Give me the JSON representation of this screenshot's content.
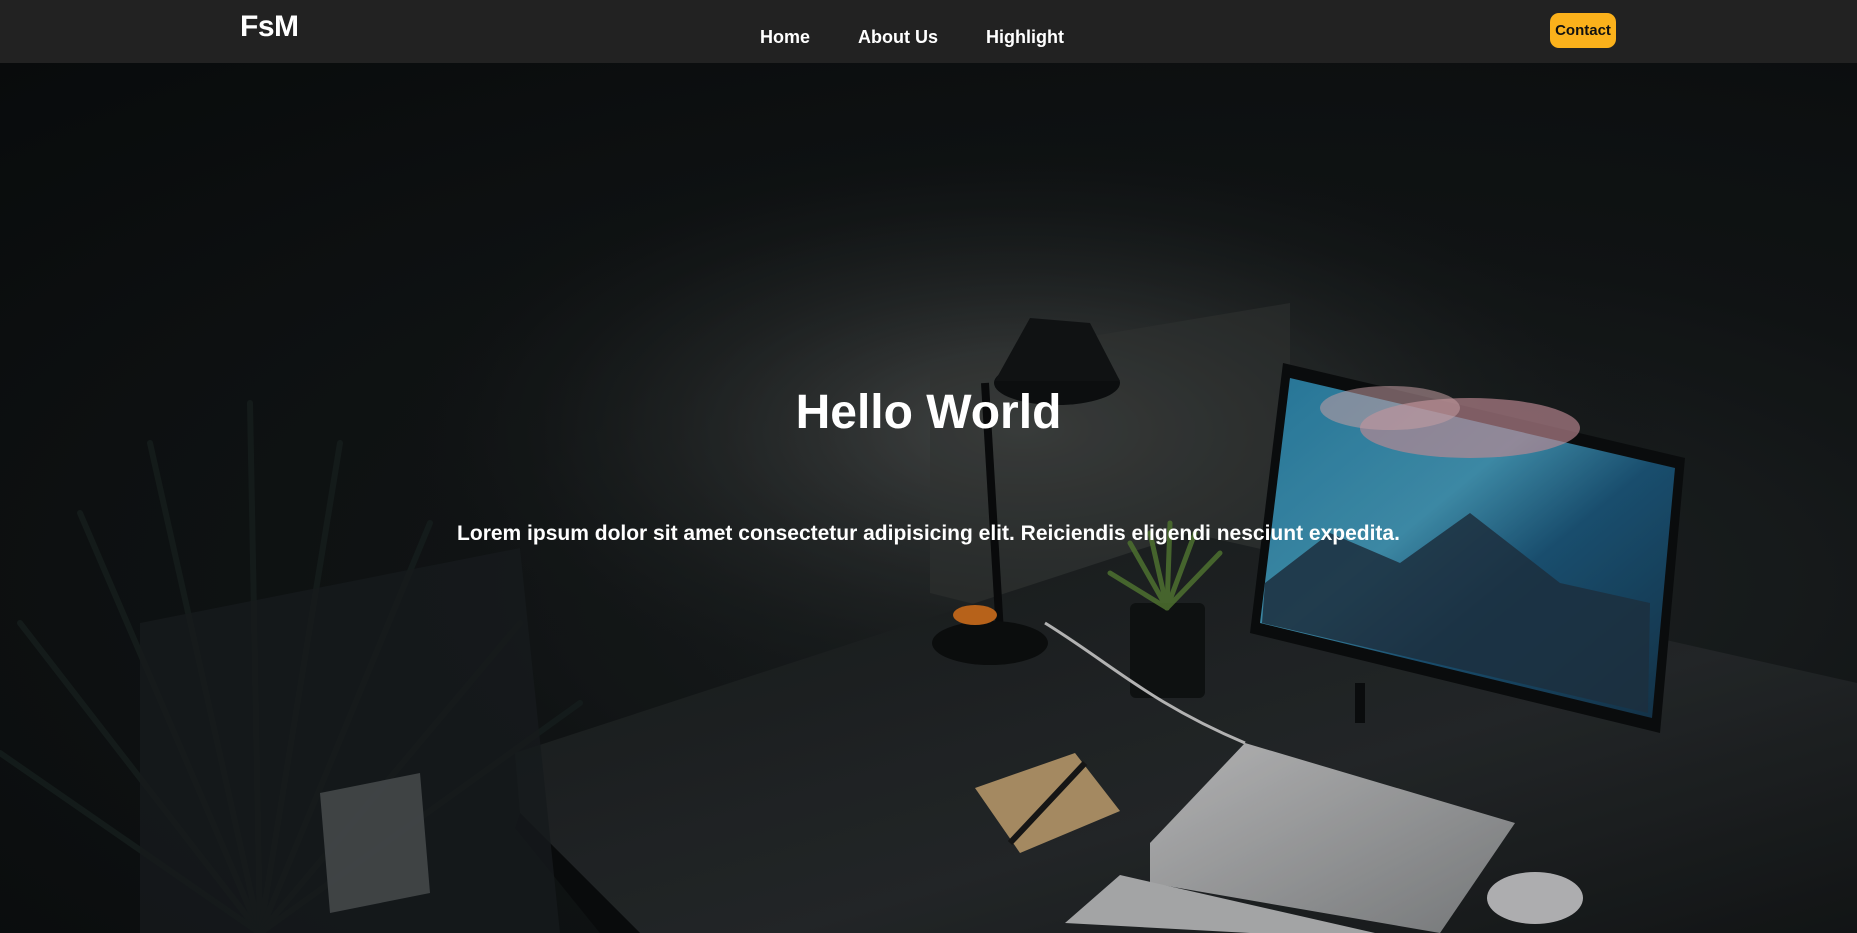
{
  "header": {
    "logo": "FsM",
    "nav": [
      {
        "label": "Home"
      },
      {
        "label": "About Us"
      },
      {
        "label": "Highlight"
      }
    ],
    "contact_label": "Contact"
  },
  "hero": {
    "title": "Hello World",
    "subtitle": "Lorem ipsum dolor sit amet consectetur adipisicing elit. Reiciendis eligendi nesciunt expedita.",
    "background_image": "dark desk setup with monitor, lamp, plant, laptop and keyboard"
  },
  "colors": {
    "navbar_bg": "#222222",
    "accent": "#fbb11b",
    "text": "#ffffff"
  }
}
